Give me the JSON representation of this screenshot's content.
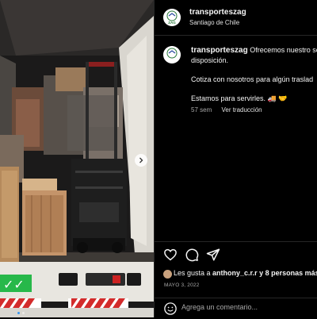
{
  "post": {
    "username": "transporteszag",
    "location": "Santiago de Chile",
    "caption_lines": [
      "Ofrecemos nuestro ser",
      "disposición.",
      "Cotiza con nosotros para algún traslad",
      "Estamos para servirles. 🚚 🤝"
    ],
    "time_ago": "57 sem",
    "see_translation": "Ver traducción",
    "likes_prefix": "Les gusta a ",
    "likes_user": "anthony_c.r.r",
    "likes_suffix": " y 8 personas más",
    "date": "MAYO 3, 2022",
    "comment_placeholder": "Agrega un comentario..."
  },
  "avatar_logo_text": "ZAG",
  "icons": [
    "heart-icon",
    "comment-icon",
    "share-icon",
    "emoji-icon",
    "chevron-right-icon"
  ],
  "colors": {
    "background": "#000000",
    "text": "#f5f5f5",
    "muted": "#a8a8a8",
    "divider": "#262626",
    "accent": "#3897f0"
  },
  "carousel": {
    "total_dots": 2,
    "active_dot": 0
  }
}
